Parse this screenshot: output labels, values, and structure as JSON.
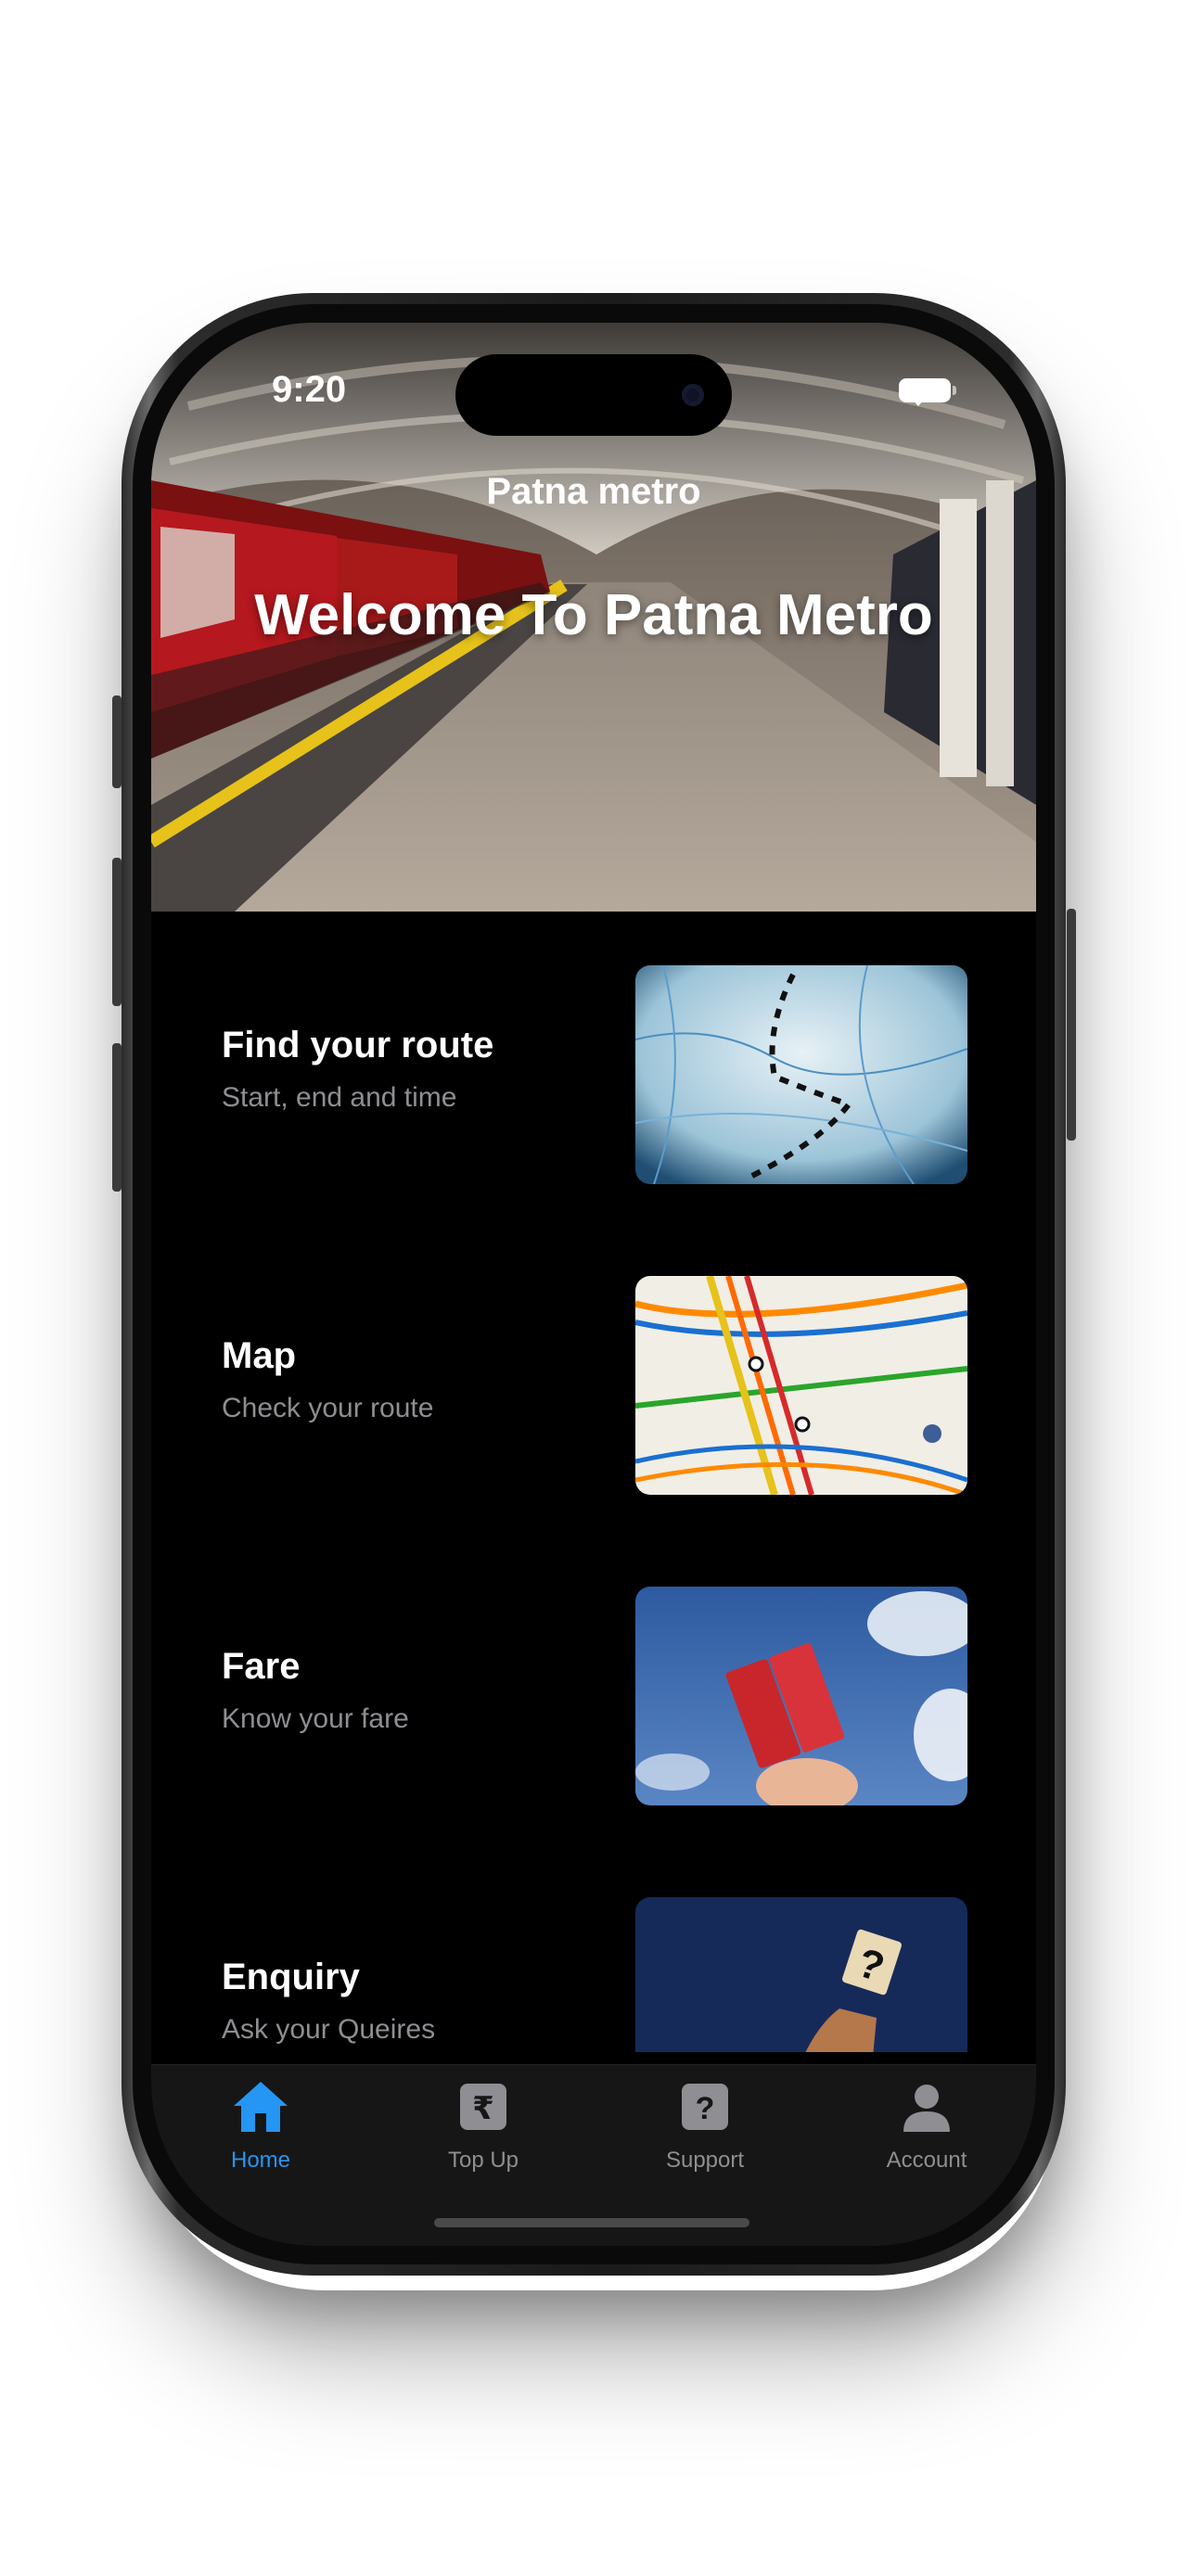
{
  "status_bar": {
    "time": "9:20"
  },
  "nav": {
    "title": "Patna metro"
  },
  "hero": {
    "headline": "Welcome To Patna Metro"
  },
  "cards": [
    {
      "title": "Find your route",
      "subtitle": "Start, end and time",
      "image": "map-with-dotted-path"
    },
    {
      "title": "Map",
      "subtitle": "Check your route",
      "image": "subway-map"
    },
    {
      "title": "Fare",
      "subtitle": "Know your fare",
      "image": "tickets-in-hand"
    },
    {
      "title": "Enquiry",
      "subtitle": "Ask your Queires",
      "image": "question-mark-card"
    }
  ],
  "tabs": [
    {
      "label": "Home",
      "icon": "house-icon",
      "active": true
    },
    {
      "label": "Top Up",
      "icon": "rupee-icon",
      "active": false
    },
    {
      "label": "Support",
      "icon": "question-icon",
      "active": false
    },
    {
      "label": "Account",
      "icon": "person-icon",
      "active": false
    }
  ],
  "colors": {
    "accent": "#2596f3",
    "background": "#000000",
    "subtitle": "#8e8e93",
    "tabbar": "#161616"
  }
}
